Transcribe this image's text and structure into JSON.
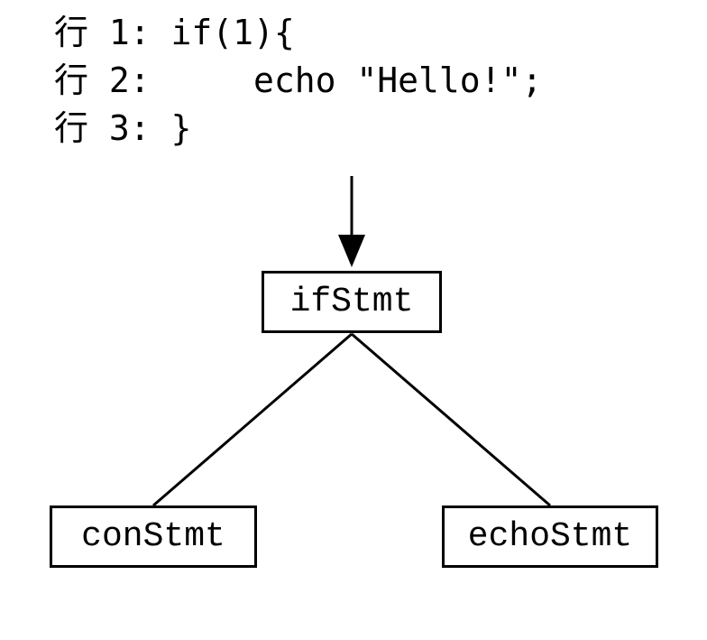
{
  "code": {
    "line1_prefix": "行 1: ",
    "line1_code": "if(1){",
    "line2_prefix": "行 2:     ",
    "line2_code": "echo \"Hello!\";",
    "line3_prefix": "行 3: ",
    "line3_code": "}"
  },
  "tree": {
    "root": "ifStmt",
    "left": "conStmt",
    "right": "echoStmt"
  }
}
